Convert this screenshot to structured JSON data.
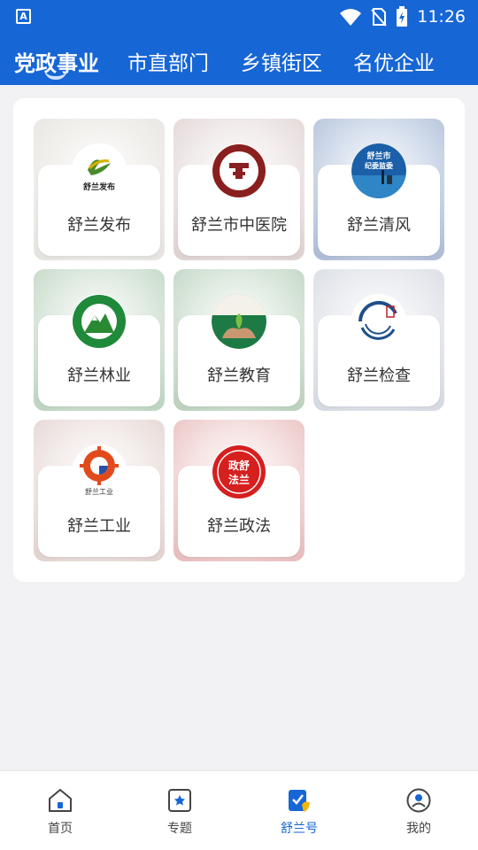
{
  "status_bar": {
    "time": "11:26",
    "app_letter": "A"
  },
  "top_tabs": [
    {
      "label": "党政事业",
      "active": true
    },
    {
      "label": "市直部门",
      "active": false
    },
    {
      "label": "乡镇街区",
      "active": false
    },
    {
      "label": "名优企业",
      "active": false
    }
  ],
  "tiles": [
    {
      "label": "舒兰发布",
      "logo_text": "舒兰发布",
      "icon": "shulan-fabu-logo"
    },
    {
      "label": "舒兰市中医院",
      "icon": "tcm-hospital-logo"
    },
    {
      "label": "舒兰清风",
      "logo_text_1": "舒兰市",
      "logo_text_2": "纪委监委",
      "icon": "qingfeng-logo"
    },
    {
      "label": "舒兰林业",
      "icon": "forestry-logo"
    },
    {
      "label": "舒兰教育",
      "icon": "education-logo"
    },
    {
      "label": "舒兰检查",
      "icon": "procuratorate-logo"
    },
    {
      "label": "舒兰工业",
      "logo_text": "舒兰工业",
      "icon": "industry-logo"
    },
    {
      "label": "舒兰政法",
      "logo_text_1": "政舒",
      "logo_text_2": "法兰",
      "icon": "politics-law-logo"
    }
  ],
  "bottom_nav": [
    {
      "label": "首页",
      "icon": "home-icon",
      "active": false
    },
    {
      "label": "专题",
      "icon": "topic-icon",
      "active": false
    },
    {
      "label": "舒兰号",
      "icon": "shulan-hao-icon",
      "active": true
    },
    {
      "label": "我的",
      "icon": "profile-icon",
      "active": false
    }
  ],
  "colors": {
    "brand": "#1666d6",
    "active_text": "#1666d6"
  }
}
